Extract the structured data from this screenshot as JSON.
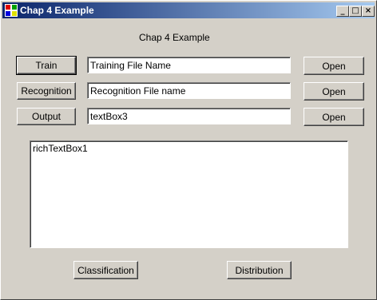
{
  "window": {
    "title": "Chap 4 Example",
    "controls": {
      "minimize": "_",
      "maximize": "□",
      "close": "×"
    }
  },
  "form": {
    "heading": "Chap 4 Example",
    "rows": [
      {
        "button": "Train",
        "text": "Training File Name",
        "open": "Open"
      },
      {
        "button": "Recognition",
        "text": "Recognition File name",
        "open": "Open"
      },
      {
        "button": "Output",
        "text": "textBox3",
        "open": "Open"
      }
    ],
    "rich_text": "richTextBox1",
    "bottom_buttons": {
      "left": "Classification",
      "right": "Distribution"
    }
  }
}
